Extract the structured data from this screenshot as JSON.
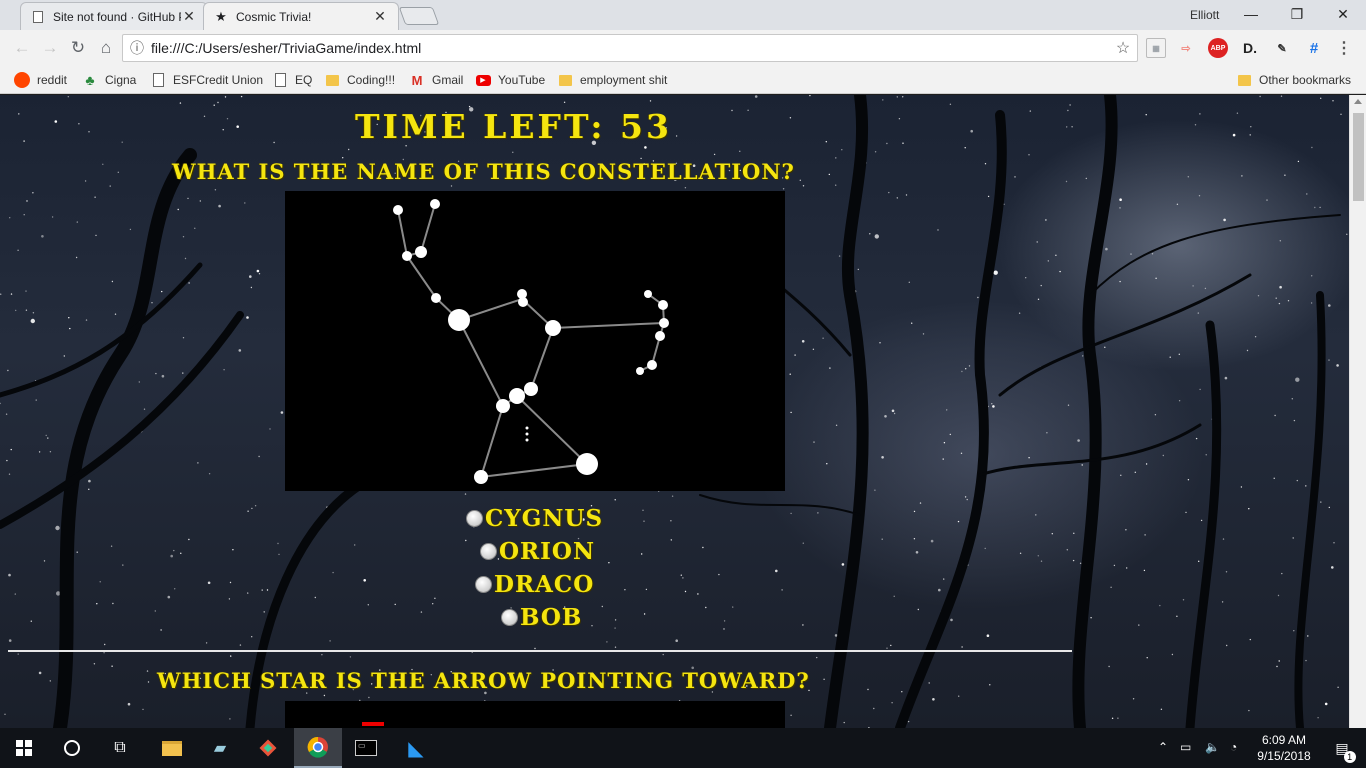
{
  "browser": {
    "tabs": [
      {
        "title": "Site not found · GitHub P",
        "icon": "page-icon",
        "active": false
      },
      {
        "title": "Cosmic Trivia!",
        "icon": "star-icon",
        "active": true
      }
    ],
    "profile_name": "Elliott",
    "address": "file:///C:/Users/esher/TriviaGame/index.html",
    "bookmarks": [
      {
        "label": "reddit",
        "icon": "reddit-icon"
      },
      {
        "label": "Cigna",
        "icon": "cigna-icon"
      },
      {
        "label": "ESFCredit Union",
        "icon": "page-icon"
      },
      {
        "label": "EQ",
        "icon": "page-icon"
      },
      {
        "label": "Coding!!!",
        "icon": "folder-icon"
      },
      {
        "label": "Gmail",
        "icon": "gmail-icon"
      },
      {
        "label": "YouTube",
        "icon": "youtube-icon"
      },
      {
        "label": "employment shit",
        "icon": "folder-icon"
      }
    ],
    "other_bookmarks": "Other bookmarks",
    "extensions": [
      "ABP",
      "D."
    ]
  },
  "page": {
    "timer_text": "Time Left: 53",
    "question1": "What is the name of this constellation?",
    "answers1": [
      "Cygnus",
      "Orion",
      "Draco",
      "Bob"
    ],
    "question2": "Which star is the arrow pointing toward?"
  },
  "taskbar": {
    "apps": [
      "windows-start-icon",
      "cortana-icon",
      "task-view-icon",
      "file-explorer-icon",
      "app-icon",
      "git-icon",
      "chrome-icon",
      "terminal-icon",
      "vscode-icon"
    ],
    "time": "6:09 AM",
    "date": "9/15/2018",
    "notification_count": "1"
  },
  "colors": {
    "accent_text": "#f5e50f",
    "taskbar": "#101318",
    "chrome_frame": "#dee1e6"
  }
}
